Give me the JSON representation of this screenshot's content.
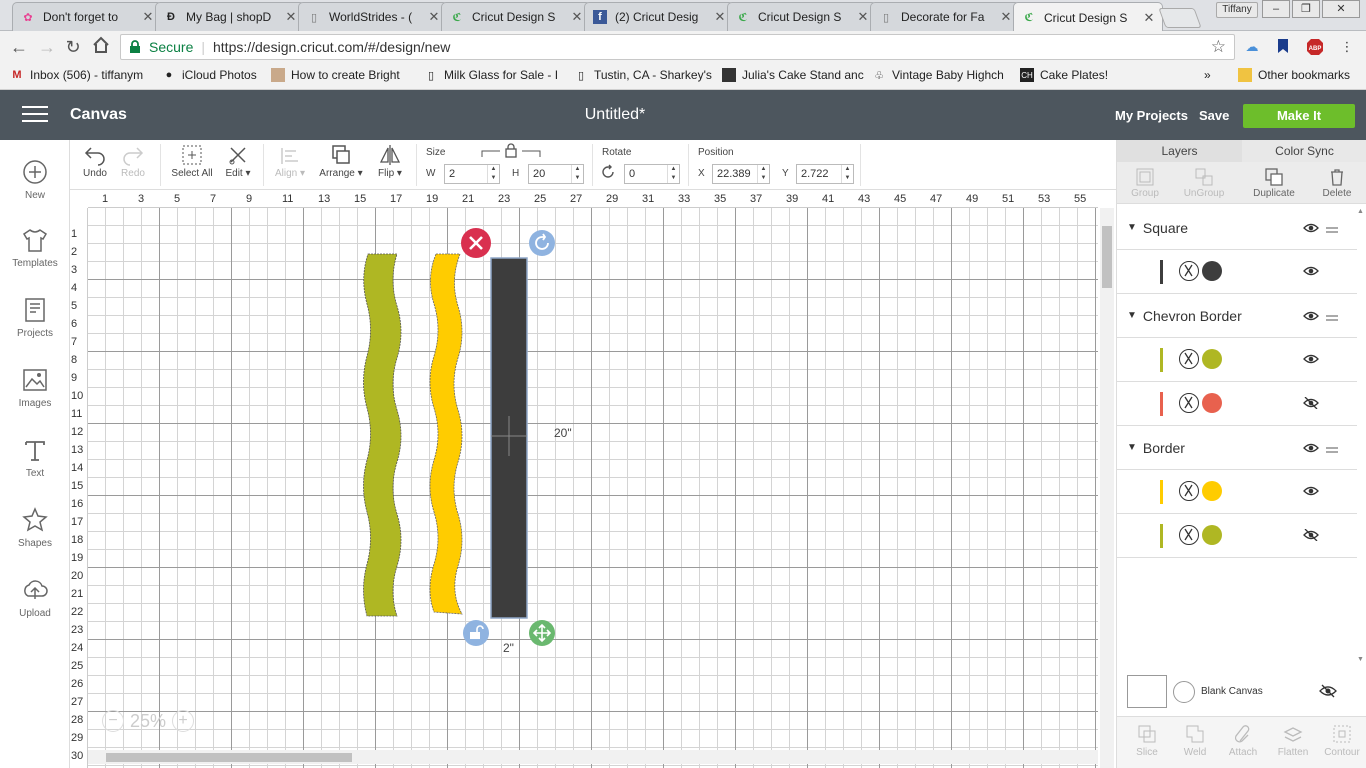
{
  "browser": {
    "tabs": [
      {
        "title": "Don't forget to",
        "favicon": "flower-icon"
      },
      {
        "title": "My Bag | shopD",
        "favicon": "shopdisney-icon"
      },
      {
        "title": "WorldStrides - (",
        "favicon": "page-icon"
      },
      {
        "title": "Cricut Design S",
        "favicon": "cricut-icon"
      },
      {
        "title": "(2) Cricut Desig",
        "favicon": "facebook-icon"
      },
      {
        "title": "Cricut Design S",
        "favicon": "cricut-icon"
      },
      {
        "title": "Decorate for Fa",
        "favicon": "page-icon"
      },
      {
        "title": "Cricut Design S",
        "favicon": "cricut-icon"
      }
    ],
    "profile": "Tiffany",
    "secure_label": "Secure",
    "url": "https://design.cricut.com/#/design/new",
    "bookmarks": [
      "Inbox (506) - tiffanym",
      "iCloud Photos",
      "How to create Bright",
      "Milk Glass for Sale - I",
      "Tustin, CA - Sharkey's",
      "Julia's Cake Stand anc",
      "Vintage Baby Highch",
      "Cake Plates!"
    ],
    "bookmarks_more": "»",
    "other_bookmarks": "Other bookmarks"
  },
  "app": {
    "section": "Canvas",
    "doc_title": "Untitled*",
    "my_projects": "My Projects",
    "save": "Save",
    "make_it": "Make It",
    "accent": "#6dbe2b",
    "header_bg": "#4d565e"
  },
  "sidebar": [
    {
      "label": "New",
      "icon": "plus-circle-icon"
    },
    {
      "label": "Templates",
      "icon": "tshirt-icon"
    },
    {
      "label": "Projects",
      "icon": "projects-icon"
    },
    {
      "label": "Images",
      "icon": "image-icon"
    },
    {
      "label": "Text",
      "icon": "text-icon"
    },
    {
      "label": "Shapes",
      "icon": "shapes-icon"
    },
    {
      "label": "Upload",
      "icon": "upload-icon"
    }
  ],
  "toolbar": {
    "undo": "Undo",
    "redo": "Redo",
    "select_all": "Select All",
    "edit": "Edit",
    "align": "Align",
    "arrange": "Arrange",
    "flip": "Flip",
    "size_label": "Size",
    "w_label": "W",
    "w_value": "2",
    "h_label": "H",
    "h_value": "20",
    "rotate_label": "Rotate",
    "rotate_value": "0",
    "position_label": "Position",
    "x_label": "X",
    "x_value": "22.389",
    "y_label": "Y",
    "y_value": "2.722"
  },
  "ruler": {
    "h_labels": [
      "1",
      "3",
      "5",
      "7",
      "9",
      "11",
      "13",
      "15",
      "17",
      "19",
      "21",
      "23",
      "25",
      "27",
      "29",
      "31",
      "33",
      "35",
      "37",
      "39",
      "41",
      "43",
      "45",
      "47",
      "49",
      "51",
      "53",
      "55"
    ],
    "v_labels": [
      "1",
      "2",
      "3",
      "4",
      "5",
      "6",
      "7",
      "8",
      "9",
      "10",
      "11",
      "12",
      "13",
      "14",
      "15",
      "16",
      "17",
      "18",
      "19",
      "20",
      "21",
      "22",
      "23",
      "24",
      "25",
      "26",
      "27",
      "28",
      "29",
      "30"
    ]
  },
  "canvas": {
    "height_dim": "20\"",
    "width_dim": "2\"",
    "zoom": "25%",
    "zoom_minus": "−",
    "zoom_plus": "+",
    "colors": {
      "green": "#afb723",
      "yellow": "#ffcc00",
      "square": "#3d3d3d",
      "delete": "#d9304f",
      "rotate": "#8fb3e0",
      "lock": "#8fb3e0",
      "resize": "#6ab86f"
    }
  },
  "rightpanel": {
    "tabs": [
      "Layers",
      "Color Sync"
    ],
    "tools": [
      "Group",
      "UnGroup",
      "Duplicate",
      "Delete"
    ],
    "groups": [
      {
        "name": "Square",
        "rows": [
          {
            "color": "#3d3d3d",
            "hidden": false
          }
        ]
      },
      {
        "name": "Chevron Border",
        "rows": [
          {
            "color": "#afb723",
            "hidden": false
          },
          {
            "color": "#e8614e",
            "hidden": true
          }
        ]
      },
      {
        "name": "Border",
        "rows": [
          {
            "color": "#ffcc00",
            "hidden": false
          },
          {
            "color": "#afb723",
            "hidden": true
          }
        ]
      }
    ],
    "blank_canvas": "Blank Canvas",
    "bottom_tools": [
      "Slice",
      "Weld",
      "Attach",
      "Flatten",
      "Contour"
    ]
  }
}
